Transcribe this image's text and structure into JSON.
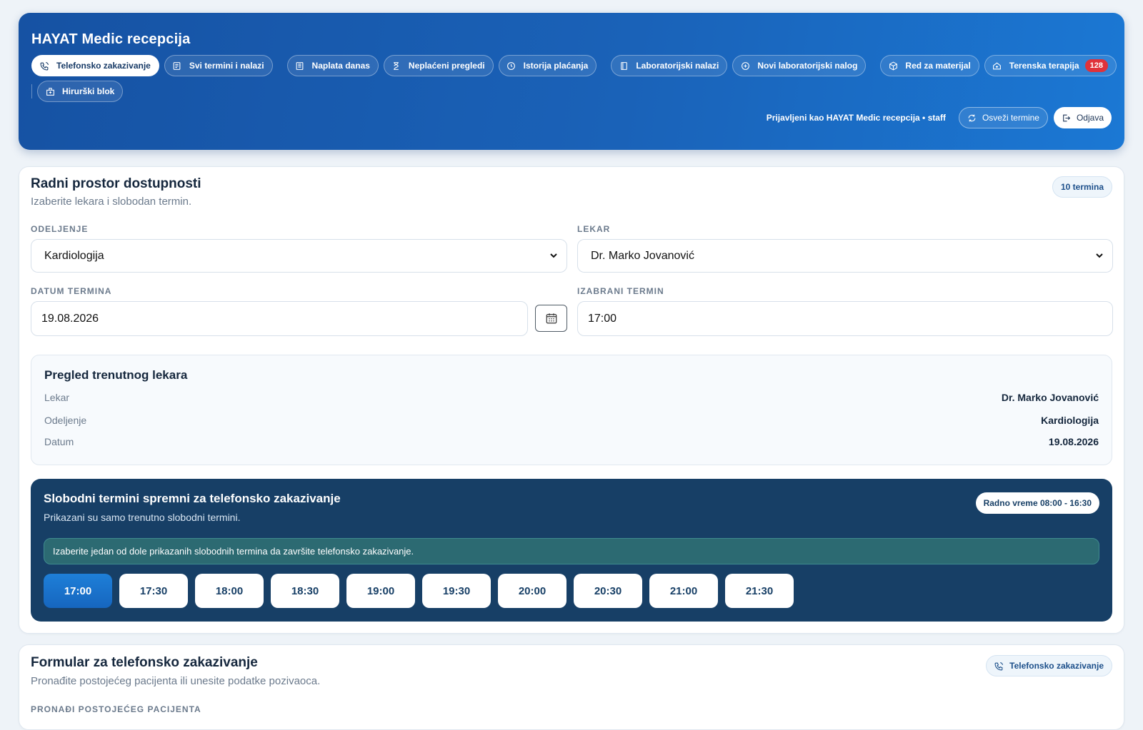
{
  "app": {
    "title": "HAYAT Medic recepcija"
  },
  "nav": {
    "row1": [
      {
        "label": "Telefonsko zakazivanje",
        "icon": "phone-icon",
        "active": true
      },
      {
        "label": "Svi termini i nalazi",
        "icon": "list-icon"
      },
      {
        "label": "Naplata danas",
        "icon": "receipt-icon"
      },
      {
        "label": "Neplaćeni pregledi",
        "icon": "hourglass-icon"
      },
      {
        "label": "Istorija plaćanja",
        "icon": "clock-icon"
      },
      {
        "label": "Laboratorijski nalazi",
        "icon": "book-icon"
      },
      {
        "label": "Novi laboratorijski nalog",
        "icon": "plus-circle-icon"
      },
      {
        "label": "Red za materijal",
        "icon": "box-icon"
      },
      {
        "label": "Terenska terapija",
        "icon": "home-medical-icon",
        "badge": "128"
      }
    ],
    "row2": [
      {
        "label": "Hirurški blok",
        "icon": "hospital-icon"
      }
    ]
  },
  "user": {
    "logged_in_text": "Prijavljeni kao HAYAT Medic recepcija • staff",
    "refresh_label": "Osveži termine",
    "logout_label": "Odjava"
  },
  "workspace": {
    "title": "Radni prostor dostupnosti",
    "subtitle": "Izaberite lekara i slobodan termin.",
    "count_badge": "10 termina",
    "department_label": "ODELJENJE",
    "department_value": "Kardiologija",
    "doctor_label": "LEKAR",
    "doctor_value": "Dr. Marko Jovanović",
    "date_label": "DATUM TERMINA",
    "date_value": "19.08.2026",
    "selected_label": "IZABRANI TERMIN",
    "selected_value": "17:00"
  },
  "overview": {
    "title": "Pregled trenutnog lekara",
    "rows": [
      {
        "key": "Lekar",
        "value": "Dr. Marko Jovanović"
      },
      {
        "key": "Odeljenje",
        "value": "Kardiologija"
      },
      {
        "key": "Datum",
        "value": "19.08.2026"
      }
    ]
  },
  "slots": {
    "title": "Slobodni termini spremni za telefonsko zakazivanje",
    "subtitle": "Prikazani su samo trenutno slobodni termini.",
    "hours_badge": "Radno vreme 08:00 - 16:30",
    "info": "Izaberite jedan od dole prikazanih slobodnih termina da završite telefonsko zakazivanje.",
    "times": [
      "17:00",
      "17:30",
      "18:00",
      "18:30",
      "19:00",
      "19:30",
      "20:00",
      "20:30",
      "21:00",
      "21:30"
    ],
    "selected": "17:00"
  },
  "form": {
    "title": "Formular za telefonsko zakazivanje",
    "subtitle": "Pronađite postojećeg pacijenta ili unesite podatke pozivaoca.",
    "tag": "Telefonsko zakazivanje",
    "find_label": "PRONAĐI POSTOJEĆEG PACIJENTA"
  },
  "colors": {
    "header_gradient_start": "#1652a3",
    "header_gradient_end": "#1b78d4",
    "slots_panel": "#173f66",
    "selected_slot": "#1e7fd8",
    "count_badge": "#e0323a"
  }
}
